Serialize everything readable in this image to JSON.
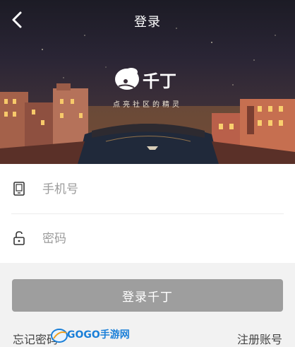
{
  "header": {
    "title": "登录",
    "back_icon": "chevron-left-icon"
  },
  "brand": {
    "logo_text": "千丁",
    "slogan": "点亮社区的精灵"
  },
  "form": {
    "phone": {
      "placeholder": "手机号",
      "value": "",
      "icon": "phone-icon"
    },
    "password": {
      "placeholder": "密码",
      "value": "",
      "icon": "unlock-icon"
    }
  },
  "actions": {
    "login_label": "登录千丁",
    "forgot_label": "忘记密码",
    "register_label": "注册账号"
  },
  "watermark": {
    "text": "GOGO手游网"
  },
  "colors": {
    "login_button": "#9e9e9e",
    "form_bg": "#ffffff",
    "page_bg": "#f2f2f2",
    "watermark": "#1a7fd8"
  }
}
